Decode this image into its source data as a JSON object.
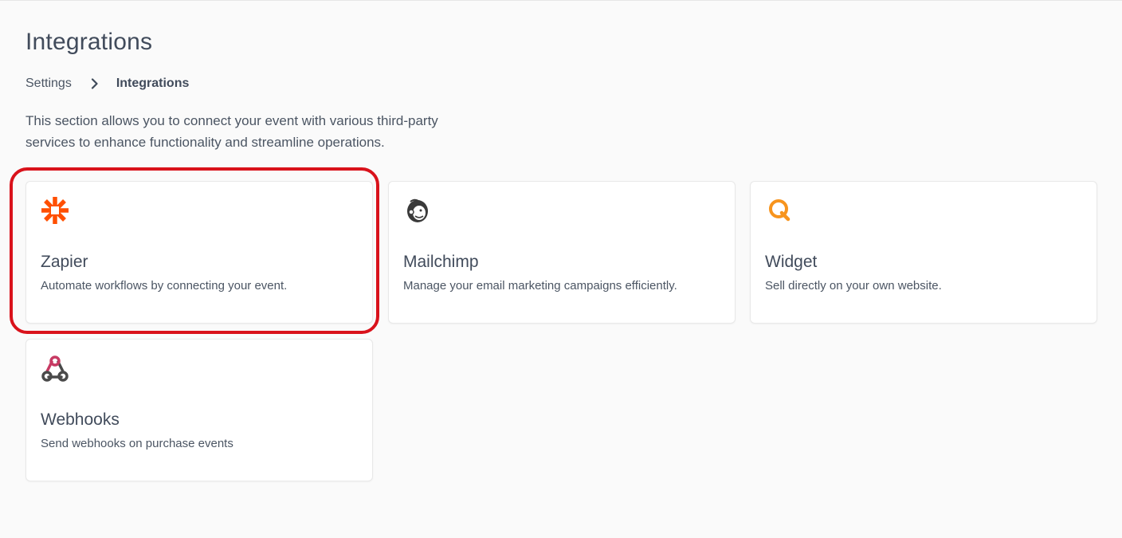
{
  "page": {
    "title": "Integrations",
    "description": "This section allows you to connect your event with various third-party services to enhance functionality and streamline operations."
  },
  "breadcrumb": {
    "items": [
      "Settings",
      "Integrations"
    ]
  },
  "integrations": [
    {
      "name": "Zapier",
      "description": "Automate workflows by connecting your event.",
      "icon": "zapier-icon",
      "color": "#ff4f00"
    },
    {
      "name": "Mailchimp",
      "description": "Manage your email marketing campaigns efficiently.",
      "icon": "mailchimp-icon",
      "color": "#3a3a3a"
    },
    {
      "name": "Widget",
      "description": "Sell directly on your own website.",
      "icon": "widget-icon",
      "color": "#f7941d"
    },
    {
      "name": "Webhooks",
      "description": "Send webhooks on purchase events",
      "icon": "webhooks-icon",
      "color": "#c73a63"
    }
  ],
  "colors": {
    "highlight": "#d9121b",
    "background": "#fafafa",
    "card": "#ffffff"
  }
}
